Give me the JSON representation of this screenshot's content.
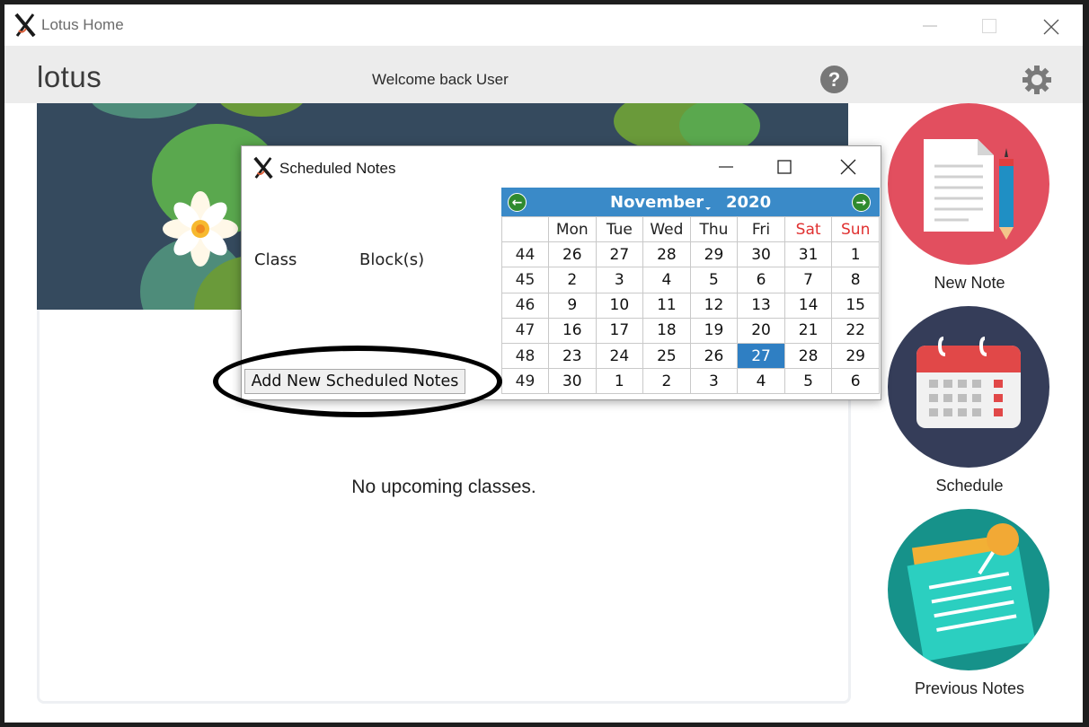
{
  "window": {
    "title": "Lotus Home",
    "controls": [
      "minimize-icon",
      "maximize-icon",
      "close-icon"
    ]
  },
  "header": {
    "brand": "lotus",
    "welcome": "Welcome back User",
    "help_label": "?"
  },
  "main": {
    "empty_message": "No upcoming classes."
  },
  "sidebar": {
    "buttons": [
      {
        "label": "New Note",
        "icon": "document-pencil-icon",
        "color": "#e24f5f"
      },
      {
        "label": "Schedule",
        "icon": "calendar-icon",
        "color": "#353d59"
      },
      {
        "label": "Previous Notes",
        "icon": "pinned-notes-icon",
        "color": "#16928a"
      }
    ]
  },
  "dialog": {
    "title": "Scheduled Notes",
    "columns": [
      "Class",
      "Block(s)"
    ],
    "add_button": "Add New Scheduled Notes"
  },
  "calendar": {
    "month": "November",
    "year": "2020",
    "weekdays": [
      "Mon",
      "Tue",
      "Wed",
      "Thu",
      "Fri",
      "Sat",
      "Sun"
    ],
    "weeks": [
      {
        "week": "44",
        "days": [
          "26",
          "27",
          "28",
          "29",
          "30",
          "31",
          "1"
        ]
      },
      {
        "week": "45",
        "days": [
          "2",
          "3",
          "4",
          "5",
          "6",
          "7",
          "8"
        ]
      },
      {
        "week": "46",
        "days": [
          "9",
          "10",
          "11",
          "12",
          "13",
          "14",
          "15"
        ]
      },
      {
        "week": "47",
        "days": [
          "16",
          "17",
          "18",
          "19",
          "20",
          "21",
          "22"
        ]
      },
      {
        "week": "48",
        "days": [
          "23",
          "24",
          "25",
          "26",
          "27",
          "28",
          "29"
        ]
      },
      {
        "week": "49",
        "days": [
          "30",
          "1",
          "2",
          "3",
          "4",
          "5",
          "6"
        ]
      }
    ],
    "selected_day": "27",
    "header_color": "#3a8ac8",
    "selected_color": "#2f7fc3",
    "weekend_color": "#e03030"
  }
}
